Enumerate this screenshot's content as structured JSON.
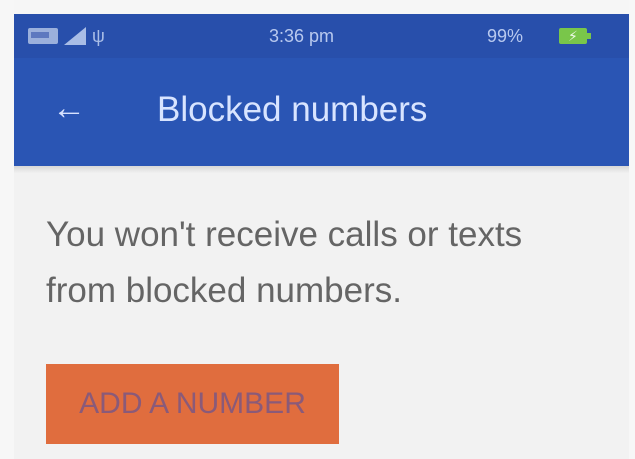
{
  "status_bar": {
    "time": "3:36 pm",
    "battery_percent": "99%",
    "icons": {
      "sim": "sim-icon",
      "signal": "signal-icon",
      "usb": "usb-icon",
      "battery": "battery-icon"
    }
  },
  "app_bar": {
    "title": "Blocked numbers",
    "back_icon": "back-arrow-icon",
    "back_glyph": "←"
  },
  "content": {
    "info_text": "You won't receive calls or texts from blocked numbers.",
    "add_button_label": "ADD A NUMBER"
  },
  "colors": {
    "app_bar": "#2a55b4",
    "status_bar": "#284fab",
    "background": "#f2f2f2",
    "button": "#e06d3e",
    "button_text": "#8a5a79",
    "battery": "#79c64a"
  }
}
